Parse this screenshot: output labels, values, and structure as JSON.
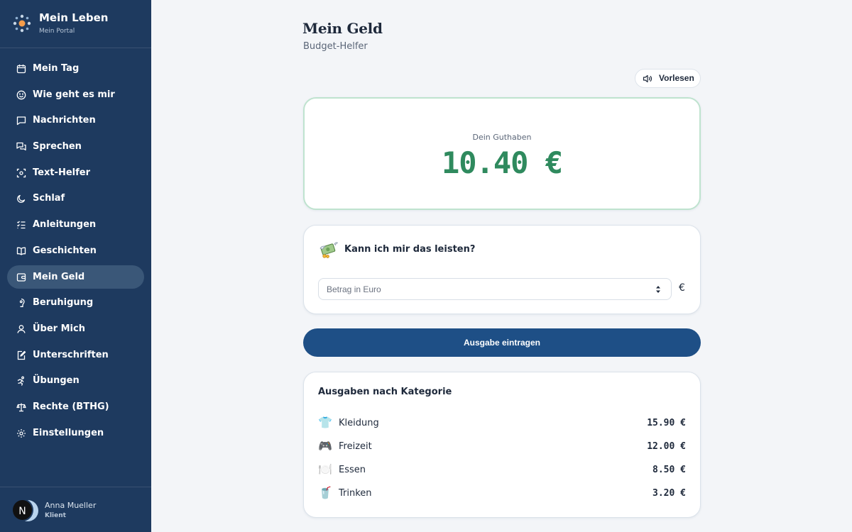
{
  "app": {
    "title": "Mein Leben",
    "subtitle": "Mein Portal"
  },
  "sidebar": {
    "items": [
      {
        "label": "Mein Tag",
        "icon": "calendar-icon",
        "active": false
      },
      {
        "label": "Wie geht es mir",
        "icon": "smiley-icon",
        "active": false
      },
      {
        "label": "Nachrichten",
        "icon": "message-icon",
        "active": false
      },
      {
        "label": "Sprechen",
        "icon": "chat-bubbles-icon",
        "active": false
      },
      {
        "label": "Text-Helfer",
        "icon": "scan-text-icon",
        "active": false
      },
      {
        "label": "Schlaf",
        "icon": "moon-icon",
        "active": false
      },
      {
        "label": "Anleitungen",
        "icon": "checklist-icon",
        "active": false
      },
      {
        "label": "Geschichten",
        "icon": "book-icon",
        "active": false
      },
      {
        "label": "Mein Geld",
        "icon": "wallet-icon",
        "active": true
      },
      {
        "label": "Beruhigung",
        "icon": "breath-icon",
        "active": false
      },
      {
        "label": "Über Mich",
        "icon": "person-icon",
        "active": false
      },
      {
        "label": "Unterschriften",
        "icon": "signature-icon",
        "active": false
      },
      {
        "label": "Übungen",
        "icon": "exercise-icon",
        "active": false
      },
      {
        "label": "Rechte (BTHG)",
        "icon": "scales-icon",
        "active": false
      },
      {
        "label": "Einstellungen",
        "icon": "gear-icon",
        "active": false
      }
    ]
  },
  "user": {
    "initial": "N",
    "name": "Anna Mueller",
    "role": "Klient"
  },
  "main": {
    "title": "Mein Geld",
    "subtitle": "Budget-Helfer",
    "read_aloud": "Vorlesen",
    "balance": {
      "label": "Dein Guthaben",
      "value": "10.40 €"
    },
    "afford": {
      "title": "Kann ich mir das leisten?",
      "placeholder": "Betrag in Euro",
      "value": "",
      "currency": "€"
    },
    "submit_label": "Ausgabe eintragen",
    "categories": {
      "title": "Ausgaben nach Kategorie",
      "rows": [
        {
          "icon": "shirt-icon",
          "glyph": "👕",
          "name": "Kleidung",
          "amount": "15.90 €"
        },
        {
          "icon": "gamepad-icon",
          "glyph": "🎮",
          "name": "Freizeit",
          "amount": "12.00 €"
        },
        {
          "icon": "plate-icon",
          "glyph": "🍽️",
          "name": "Essen",
          "amount": "8.50 €"
        },
        {
          "icon": "drink-icon",
          "glyph": "🥤",
          "name": "Trinken",
          "amount": "3.20 €"
        }
      ]
    }
  },
  "colors": {
    "sidebar": "#1e3a5f",
    "active_item": "#3a5778",
    "balance": "#2f8a5e",
    "primary_button": "#1e4f86",
    "background": "#f3f5f8"
  }
}
